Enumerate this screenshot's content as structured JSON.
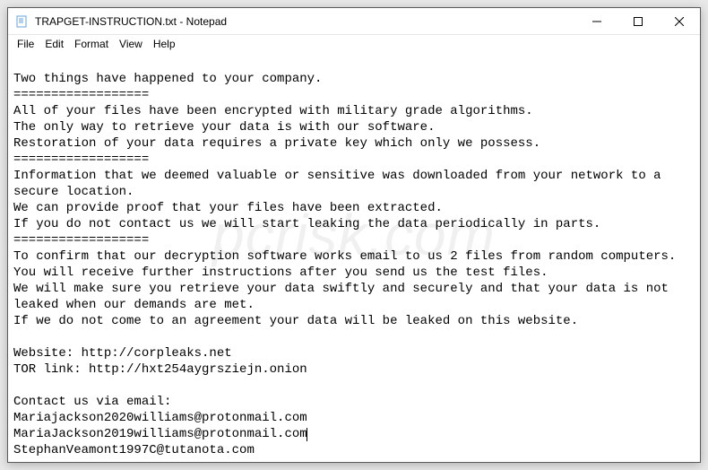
{
  "titlebar": {
    "title": "TRAPGET-INSTRUCTION.txt - Notepad"
  },
  "menu": {
    "file": "File",
    "edit": "Edit",
    "format": "Format",
    "view": "View",
    "help": "Help"
  },
  "content": {
    "line1": "Two things have happened to your company.",
    "sep1": "==================",
    "line2": "All of your files have been encrypted with military grade algorithms.",
    "line3": "The only way to retrieve your data is with our software.",
    "line4": "Restoration of your data requires a private key which only we possess.",
    "sep2": "==================",
    "line5": "Information that we deemed valuable or sensitive was downloaded from your network to a secure location.",
    "line6": "We can provide proof that your files have been extracted.",
    "line7": "If you do not contact us we will start leaking the data periodically in parts.",
    "sep3": "==================",
    "line8": "To confirm that our decryption software works email to us 2 files from random computers.",
    "line9": "You will receive further instructions after you send us the test files.",
    "line10": "We will make sure you retrieve your data swiftly and securely and that your data is not leaked when our demands are met.",
    "line11": "If we do not come to an agreement your data will be leaked on this website.",
    "blank1": "",
    "line12": "Website: http://corpleaks.net",
    "line13": "TOR link: http://hxt254aygrsziejn.onion",
    "blank2": "",
    "line14": "Contact us via email:",
    "line15": "Mariajackson2020williams@protonmail.com",
    "line16": "MariaJackson2019williams@protonmail.com",
    "line17": "StephanVeamont1997C@tutanota.com"
  },
  "watermark": "pcrisk.com"
}
